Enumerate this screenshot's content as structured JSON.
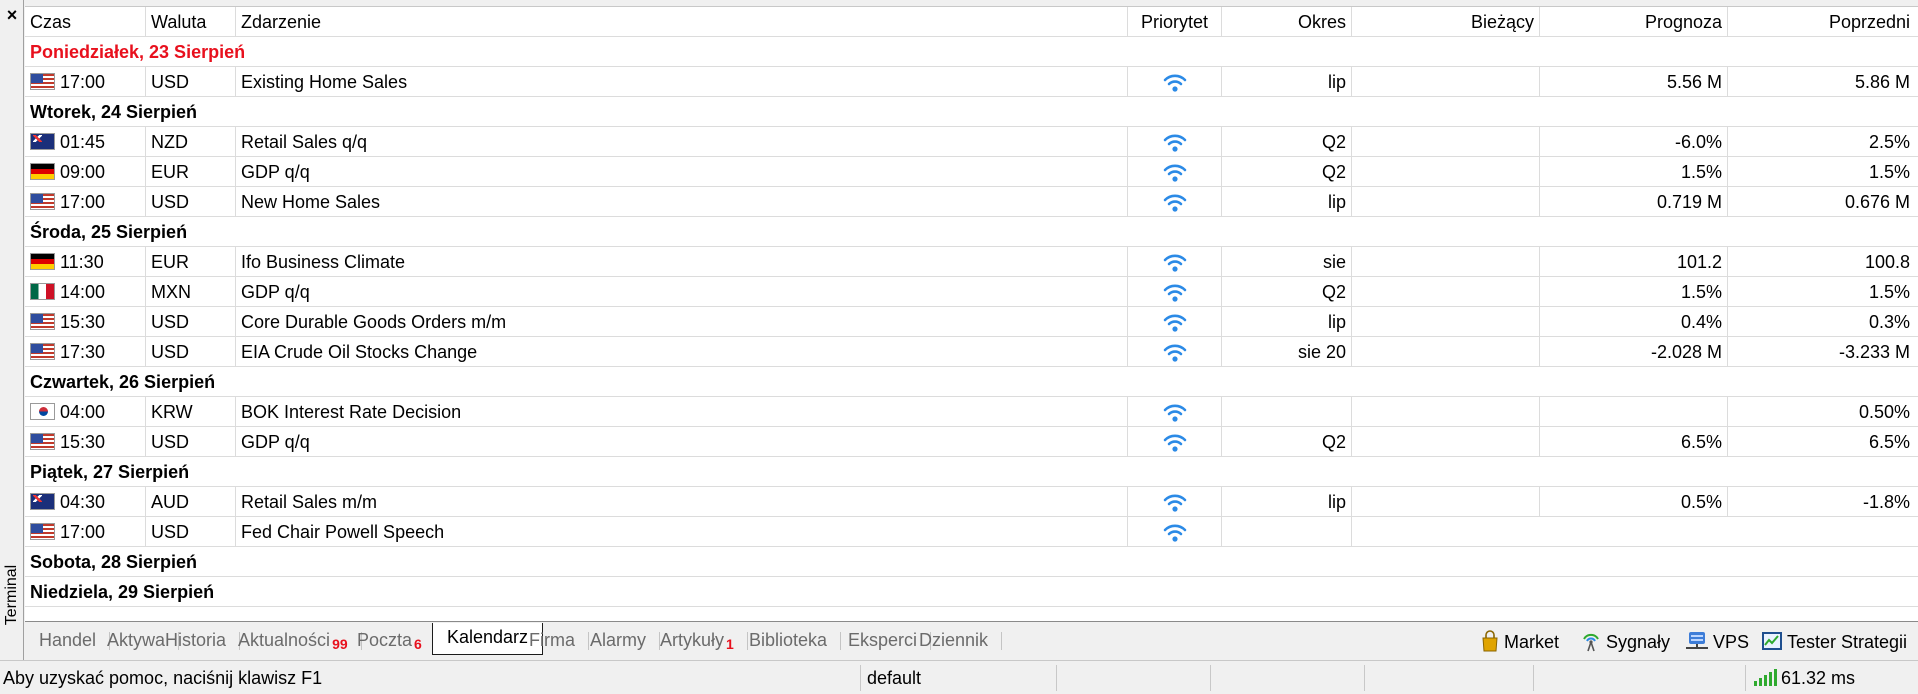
{
  "terminal": {
    "close": "×",
    "label": "Terminal"
  },
  "columns": {
    "time": "Czas",
    "currency": "Waluta",
    "event": "Zdarzenie",
    "priority": "Priorytet",
    "period": "Okres",
    "current": "Bieżący",
    "forecast": "Prognoza",
    "previous": "Poprzedni"
  },
  "rows": [
    {
      "type": "day",
      "label": "Poniedziałek, 23 Sierpień",
      "highlight": true
    },
    {
      "type": "event",
      "flag": "us",
      "time": "17:00",
      "currency": "USD",
      "event": "Existing Home Sales",
      "period": "lip",
      "current": "",
      "forecast": "5.56 M",
      "previous": "5.86 M"
    },
    {
      "type": "day",
      "label": "Wtorek, 24 Sierpień"
    },
    {
      "type": "event",
      "flag": "nz",
      "time": "01:45",
      "currency": "NZD",
      "event": "Retail Sales q/q",
      "period": "Q2",
      "current": "",
      "forecast": "-6.0%",
      "previous": "2.5%"
    },
    {
      "type": "event",
      "flag": "de",
      "time": "09:00",
      "currency": "EUR",
      "event": "GDP q/q",
      "period": "Q2",
      "current": "",
      "forecast": "1.5%",
      "previous": "1.5%"
    },
    {
      "type": "event",
      "flag": "us",
      "time": "17:00",
      "currency": "USD",
      "event": "New Home Sales",
      "period": "lip",
      "current": "",
      "forecast": "0.719 M",
      "previous": "0.676 M"
    },
    {
      "type": "day",
      "label": "Środa, 25 Sierpień"
    },
    {
      "type": "event",
      "flag": "de",
      "time": "11:30",
      "currency": "EUR",
      "event": "Ifo Business Climate",
      "period": "sie",
      "current": "",
      "forecast": "101.2",
      "previous": "100.8"
    },
    {
      "type": "event",
      "flag": "mx",
      "time": "14:00",
      "currency": "MXN",
      "event": "GDP q/q",
      "period": "Q2",
      "current": "",
      "forecast": "1.5%",
      "previous": "1.5%"
    },
    {
      "type": "event",
      "flag": "us",
      "time": "15:30",
      "currency": "USD",
      "event": "Core Durable Goods Orders m/m",
      "period": "lip",
      "current": "",
      "forecast": "0.4%",
      "previous": "0.3%"
    },
    {
      "type": "event",
      "flag": "us",
      "time": "17:30",
      "currency": "USD",
      "event": "EIA Crude Oil Stocks Change",
      "period": "sie 20",
      "current": "",
      "forecast": "-2.028 M",
      "previous": "-3.233 M"
    },
    {
      "type": "day",
      "label": "Czwartek, 26 Sierpień"
    },
    {
      "type": "event",
      "flag": "kr",
      "time": "04:00",
      "currency": "KRW",
      "event": "BOK Interest Rate Decision",
      "period": "",
      "current": "",
      "forecast": "",
      "previous": "0.50%"
    },
    {
      "type": "event",
      "flag": "us",
      "time": "15:30",
      "currency": "USD",
      "event": "GDP q/q",
      "period": "Q2",
      "current": "",
      "forecast": "6.5%",
      "previous": "6.5%"
    },
    {
      "type": "day",
      "label": "Piątek, 27 Sierpień"
    },
    {
      "type": "event",
      "flag": "au",
      "time": "04:30",
      "currency": "AUD",
      "event": "Retail Sales m/m",
      "period": "lip",
      "current": "",
      "forecast": "0.5%",
      "previous": "-1.8%"
    },
    {
      "type": "event",
      "flag": "us",
      "time": "17:00",
      "currency": "USD",
      "event": "Fed Chair Powell Speech",
      "period": "",
      "current": "",
      "forecast": "",
      "previous": "",
      "speech": true
    },
    {
      "type": "day",
      "label": "Sobota, 28 Sierpień"
    },
    {
      "type": "day",
      "label": "Niedziela, 29 Sierpień"
    }
  ],
  "tabs": [
    {
      "label": "Handel"
    },
    {
      "label": "Aktywa"
    },
    {
      "label": "Historia"
    },
    {
      "label": "Aktualności",
      "badge": "99"
    },
    {
      "label": "Poczta",
      "badge": "6"
    },
    {
      "label": "Kalendarz",
      "active": true
    },
    {
      "label": "Firma"
    },
    {
      "label": "Alarmy"
    },
    {
      "label": "Artykuły",
      "badge": "1"
    },
    {
      "label": "Biblioteka"
    },
    {
      "label": "Eksperci"
    },
    {
      "label": "Dziennik"
    }
  ],
  "tools": [
    {
      "label": "Market",
      "icon": "market-bag-icon"
    },
    {
      "label": "Sygnały",
      "icon": "signals-antenna-icon"
    },
    {
      "label": "VPS",
      "icon": "vps-server-icon"
    },
    {
      "label": "Tester Strategii",
      "icon": "strategy-tester-icon"
    }
  ],
  "status": {
    "help": "Aby uzyskać pomoc, naciśnij klawisz F1",
    "profile": "default",
    "ping": "61.32 ms"
  },
  "colors": {
    "highlight_day": "#e8101d",
    "priority_icon": "#2b8ae6",
    "badge": "#e8101d",
    "signal_bars": "#2faa2f"
  }
}
